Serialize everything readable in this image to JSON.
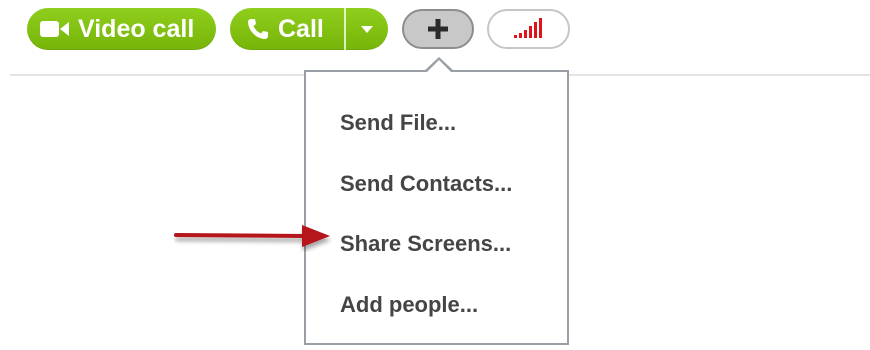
{
  "toolbar": {
    "video_call_label": "Video call",
    "call_label": "Call"
  },
  "icons": {
    "video": "video-camera-icon",
    "phone": "phone-icon",
    "dropdown": "chevron-down-icon",
    "add": "plus-icon",
    "signal": "signal-strength-icon",
    "annotation": "red-arrow-icon"
  },
  "colors": {
    "button_green": "#7fc112",
    "menu_text": "#454545",
    "menu_border": "#9a9fa5",
    "signal_red": "#e0121a",
    "arrow_red": "#b5121b"
  },
  "menu": {
    "items": [
      {
        "label": "Send File..."
      },
      {
        "label": "Send Contacts..."
      },
      {
        "label": "Share Screens..."
      },
      {
        "label": "Add people..."
      }
    ]
  }
}
